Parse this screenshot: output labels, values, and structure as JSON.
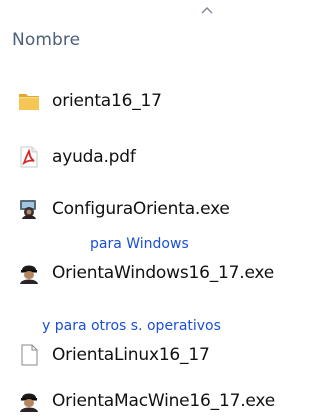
{
  "column_header": {
    "label": "Nombre",
    "sort_icon": "chevron-up-icon",
    "sort_direction": "ascending"
  },
  "files": [
    {
      "name": "orienta16_17",
      "icon": "folder-icon"
    },
    {
      "name": "ayuda.pdf",
      "icon": "pdf-icon"
    },
    {
      "name": "ConfiguraOrienta.exe",
      "icon": "app-config-icon"
    },
    {
      "name": "OrientaWindows16_17.exe",
      "icon": "app-icon"
    },
    {
      "name": "OrientaLinux16_17",
      "icon": "file-icon"
    },
    {
      "name": "OrientaMacWine16_17.exe",
      "icon": "app-icon"
    }
  ],
  "notes": {
    "windows": "para Windows",
    "others": "y para otros s. operativos"
  },
  "colors": {
    "folder": "#f2c14e",
    "pdf": "#d42a2a",
    "note_text": "#1a4fd6",
    "header_text": "#4c607a"
  }
}
